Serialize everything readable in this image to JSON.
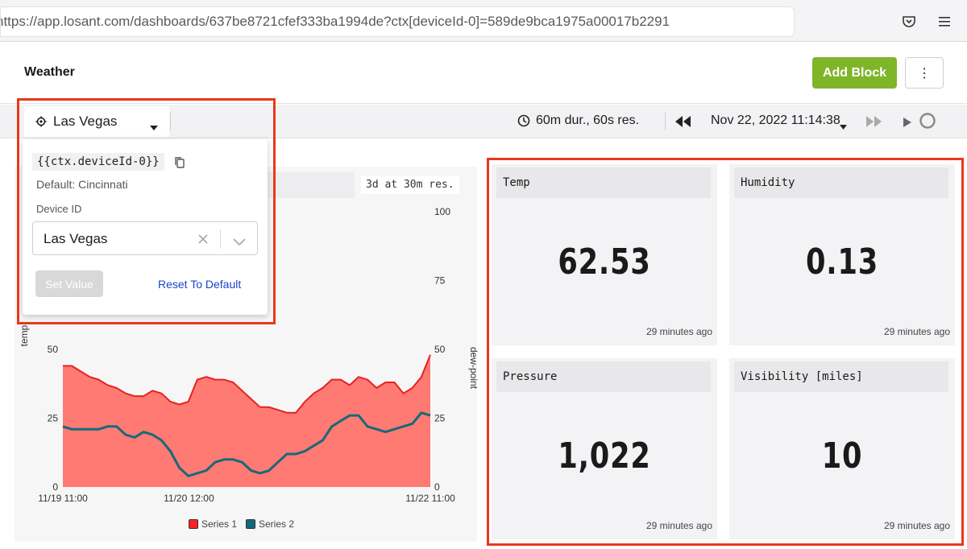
{
  "browser": {
    "url": "https://app.losant.com/dashboards/637be8721cfef333ba1994de?ctx[deviceId-0]=589de9bca1975a00017b2291",
    "icons": [
      "pocket-icon",
      "hamburger-menu-icon"
    ]
  },
  "header": {
    "title": "Weather",
    "add_block_label": "Add Block",
    "more_label": "⋮"
  },
  "toolbar": {
    "context_value": "Las Vegas",
    "duration_label": "60m dur., 60s res.",
    "date_label": "Nov 22, 2022 11:14:38"
  },
  "context_popover": {
    "variable": "{{ctx.deviceId-0}}",
    "default_label": "Default: Cincinnati",
    "field_label": "Device ID",
    "field_value": "Las Vegas",
    "set_value_label": "Set Value",
    "reset_label": "Reset To Default"
  },
  "chart_panel": {
    "resolution_tag": "3d at 30m res.",
    "chart_data": {
      "type": "area",
      "x_ticks": [
        "11/19 11:00",
        "11/20 12:00",
        "11/22 11:00"
      ],
      "y_left_label": "temp",
      "y_left_ticks": [
        "0",
        "25",
        "50"
      ],
      "y_right_label": "dew-point",
      "y_right_ticks": [
        "0",
        "25",
        "50",
        "75",
        "100"
      ],
      "ylim": [
        0,
        100
      ],
      "series": [
        {
          "name": "Series 1",
          "color": "#ff7a72",
          "line_color": "#e82020",
          "values": [
            44,
            44,
            42,
            40,
            39,
            37,
            36,
            34,
            33,
            33,
            35,
            34,
            31,
            30,
            31,
            39,
            40,
            39,
            39,
            38,
            35,
            32,
            29,
            29,
            28,
            27,
            27,
            31,
            34,
            36,
            39,
            39,
            37,
            40,
            39,
            36,
            38,
            38,
            34,
            36,
            40,
            48
          ]
        },
        {
          "name": "Series 2",
          "color": "#146a7a",
          "line_color": "#146a7a",
          "values": [
            22,
            21,
            21,
            21,
            21,
            22,
            22,
            19,
            18,
            20,
            19,
            17,
            13,
            7,
            4,
            5,
            6,
            9,
            10,
            10,
            9,
            6,
            5,
            6,
            9,
            12,
            12,
            13,
            15,
            17,
            22,
            24,
            26,
            26,
            22,
            21,
            20,
            21,
            22,
            23,
            27,
            26
          ]
        }
      ],
      "legend": [
        "Series 1",
        "Series 2"
      ]
    }
  },
  "tiles": [
    {
      "name": "Temp",
      "value": "62.53",
      "time": "29 minutes ago"
    },
    {
      "name": "Humidity",
      "value": "0.13",
      "time": "29 minutes ago"
    },
    {
      "name": "Pressure",
      "value": "1,022",
      "time": "29 minutes ago"
    },
    {
      "name": "Visibility [miles]",
      "value": "10",
      "time": "29 minutes ago"
    }
  ]
}
